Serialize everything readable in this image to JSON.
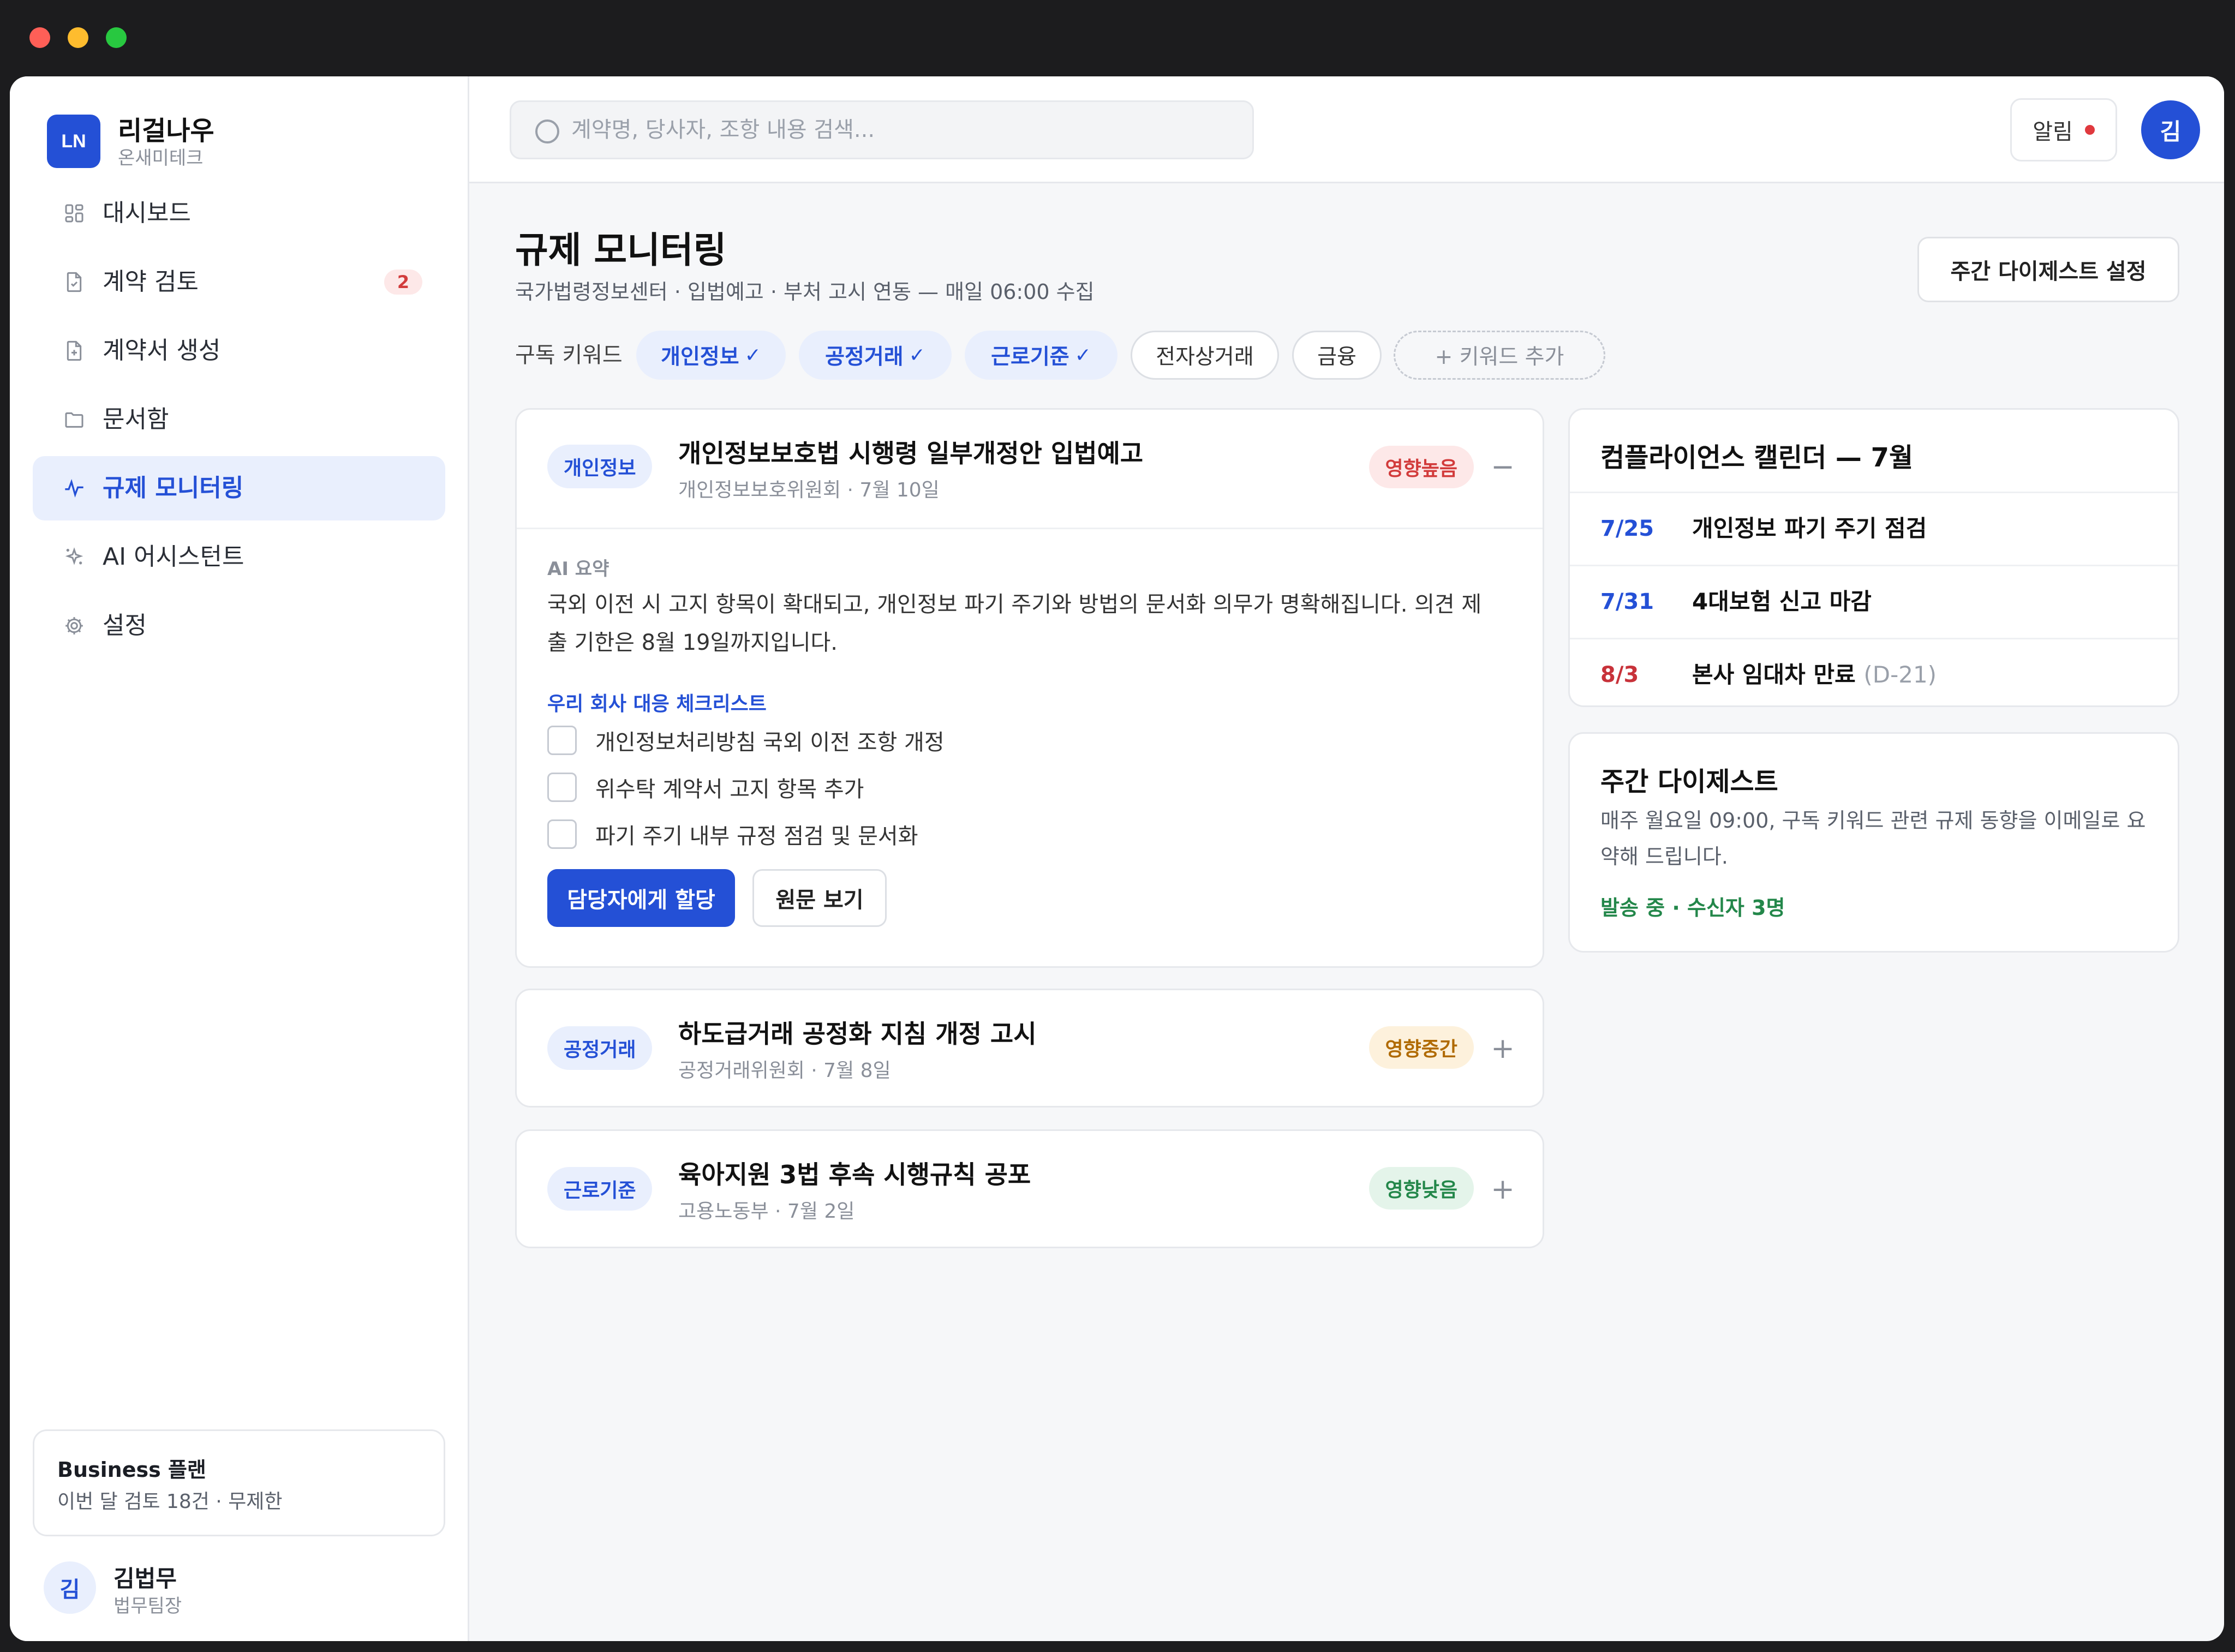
{
  "app": {
    "logo": "LN",
    "name": "리걸나우",
    "org": "온새미테크"
  },
  "sidebar": {
    "items": [
      {
        "label": "대시보드",
        "icon": "grid-icon"
      },
      {
        "label": "계약 검토",
        "icon": "document-check-icon",
        "badge": "2"
      },
      {
        "label": "계약서 생성",
        "icon": "document-plus-icon"
      },
      {
        "label": "문서함",
        "icon": "folder-icon"
      },
      {
        "label": "규제 모니터링",
        "icon": "pulse-icon",
        "active": true
      },
      {
        "label": "AI 어시스턴트",
        "icon": "sparkle-icon"
      },
      {
        "label": "설정",
        "icon": "gear-icon"
      }
    ],
    "plan": {
      "title": "Business 플랜",
      "subtitle": "이번 달 검토 18건 · 무제한"
    },
    "user": {
      "initial": "김",
      "name": "김법무",
      "role": "법무팀장"
    }
  },
  "topbar": {
    "search_placeholder": "계약명, 당사자, 조항 내용 검색...",
    "notifications_label": "알림",
    "avatar_initial": "김"
  },
  "main": {
    "title": "규제 모니터링",
    "subtitle": "국가법령정보센터 · 입법예고 · 부처 고시 연동 — 매일 06:00 수집",
    "digest_settings_button": "주간 다이제스트 설정",
    "keywords_label": "구독 키워드",
    "keywords": [
      {
        "label": "개인정보",
        "selected": true
      },
      {
        "label": "공정거래",
        "selected": true
      },
      {
        "label": "근로기준",
        "selected": true
      },
      {
        "label": "전자상거래",
        "selected": false
      },
      {
        "label": "금융",
        "selected": false
      }
    ],
    "add_keyword_label": "+ 키워드 추가",
    "check_mark": "✓",
    "feed": [
      {
        "category": "개인정보",
        "title": "개인정보보호법 시행령 일부개정안 입법예고",
        "meta": "개인정보보호위원회 · 7월 10일",
        "impact": "영향높음",
        "impact_level": "high",
        "toggle": "−",
        "expanded": true,
        "summary_label": "AI 요약",
        "summary": "국외 이전 시 고지 항목이 확대되고, 개인정보 파기 주기와 방법의 문서화 의무가 명확해집니다. 의견 제출 기한은 8월 19일까지입니다.",
        "checklist_title": "우리 회사 대응 체크리스트",
        "checklist": [
          "개인정보처리방침 국외 이전 조항 개정",
          "위수탁 계약서 고지 항목 추가",
          "파기 주기 내부 규정 점검 및 문서화"
        ],
        "assign_button": "담당자에게 할당",
        "view_original_button": "원문 보기"
      },
      {
        "category": "공정거래",
        "title": "하도급거래 공정화 지침 개정 고시",
        "meta": "공정거래위원회 · 7월 8일",
        "impact": "영향중간",
        "impact_level": "mid",
        "toggle": "+"
      },
      {
        "category": "근로기준",
        "title": "육아지원 3법 후속 시행규칙 공포",
        "meta": "고용노동부 · 7월 2일",
        "impact": "영향낮음",
        "impact_level": "low",
        "toggle": "+"
      }
    ]
  },
  "calendar": {
    "title": "컴플라이언스 캘린더 — 7월",
    "events": [
      {
        "date": "7/25",
        "text": "개인정보 파기 주기 점검",
        "color": "#2450d6"
      },
      {
        "date": "7/31",
        "text": "4대보험 신고 마감",
        "color": "#2450d6"
      },
      {
        "date": "8/3",
        "text": "본사 임대차 만료",
        "extra": "(D-21)",
        "color": "#c8323a"
      }
    ]
  },
  "digest": {
    "title": "주간 다이제스트",
    "description": "매주 월요일 09:00, 구독 키워드 관련 규제 동향을 이메일로 요약해 드립니다.",
    "status": "발송 중 · 수신자 3명"
  }
}
